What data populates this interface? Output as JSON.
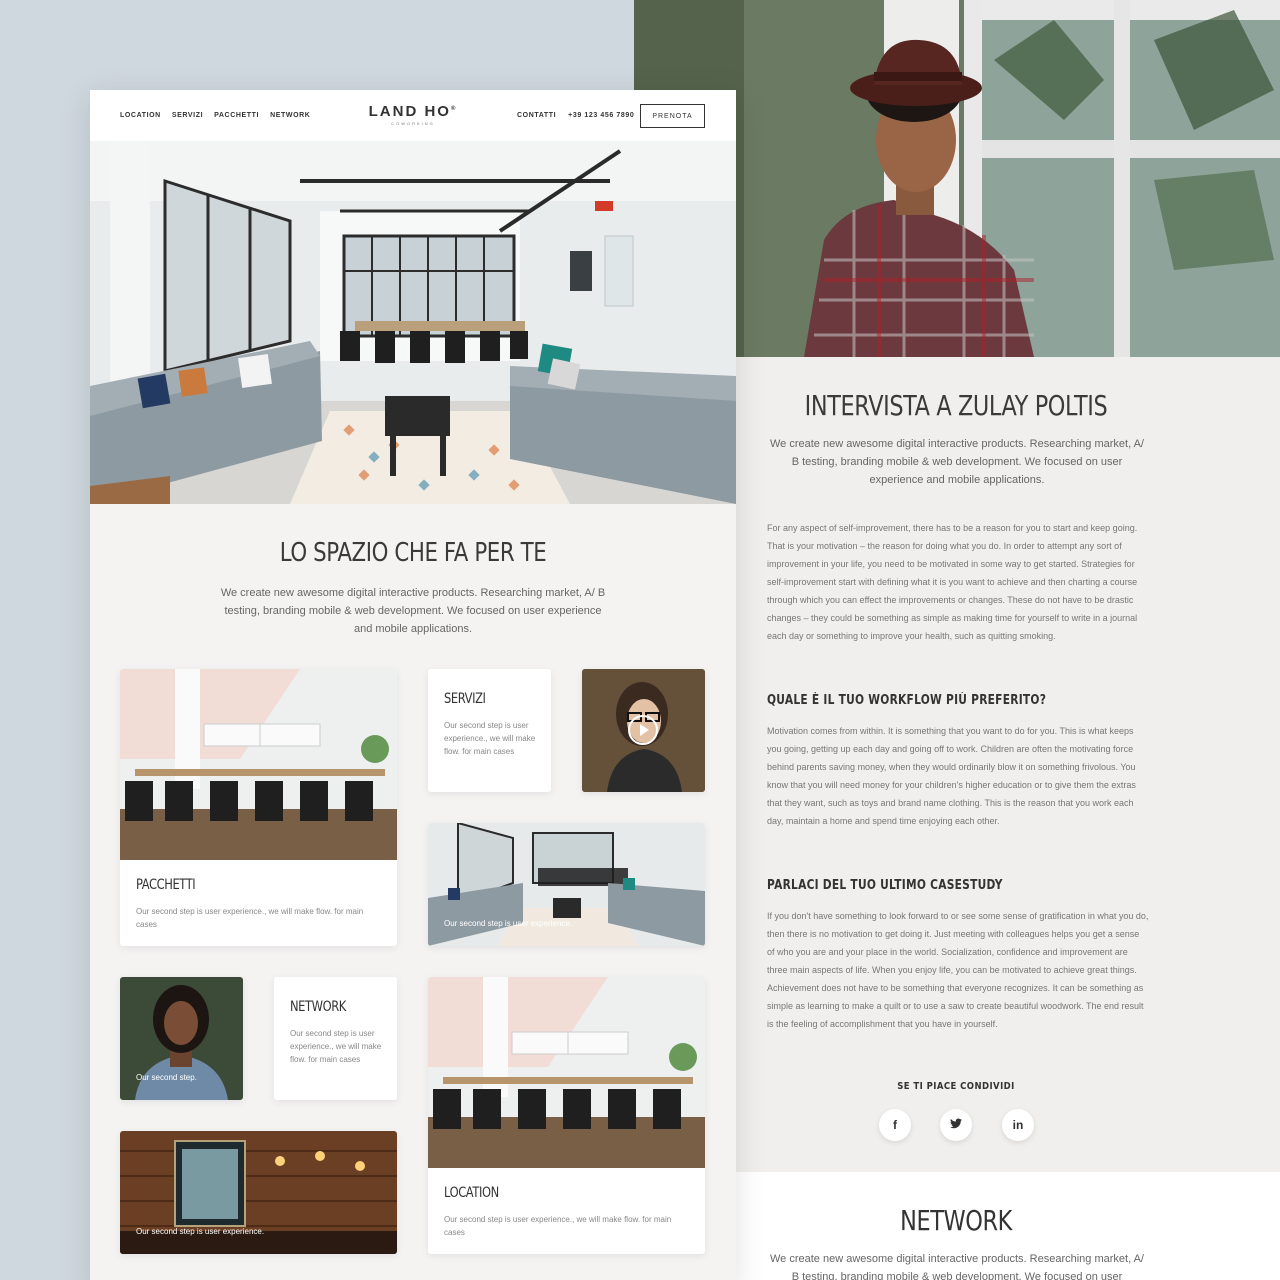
{
  "nav": {
    "links": [
      "LOCATION",
      "SERVIZI",
      "PACCHETTI",
      "NETWORK"
    ],
    "logo": "LAND HO",
    "logo_mark": "®",
    "logo_sub": "COWORKING",
    "contact": "CONTATTI",
    "phone": "+39 123 456 7890",
    "cta": "PRENOTA"
  },
  "space": {
    "title": "LO SPAZIO CHE FA PER TE",
    "description": "We create new awesome digital interactive products. Researching market, A/ B testing, branding mobile & web development. We focused on user experience and mobile applications."
  },
  "cards": {
    "pacchetti": {
      "title": "PACCHETTI",
      "text": "Our second step is user experience., we will make flow. for main cases"
    },
    "servizi": {
      "title": "SERVIZI",
      "text": "Our second step is user experience., we will make flow. for main cases"
    },
    "lounge": {
      "overlay": "Our second step is user experience."
    },
    "network": {
      "title": "NETWORK",
      "text": "Our second step is user experience., we will make flow. for main cases"
    },
    "portrait": {
      "overlay": "Our second step."
    },
    "location": {
      "title": "LOCATION",
      "text": "Our second step is user experience., we will make flow. for main cases"
    },
    "bar": {
      "overlay": "Our second step is user experience."
    }
  },
  "article": {
    "title": "INTERVISTA A ZULAY POLTIS",
    "lead": "We create new awesome digital interactive products. Researching market, A/ B testing, branding mobile & web development. We focused on user experience and mobile applications.",
    "p1": "For any aspect of self-improvement, there has to be a reason for you to start and keep going. That is your motivation – the reason for doing what you do. In order to attempt any sort of improvement in your life, you need to be motivated in some way to get started. Strategies for self-improvement start with defining what it is you want to achieve and then charting a course through which you can effect the improvements or changes. These do not have to be drastic changes – they could be something as simple as making time for yourself to write in a journal each day or something to improve your health, such as quitting smoking.",
    "h2": "QUALE È IL TUO WORKFLOW PIÙ PREFERITO?",
    "p2": "Motivation comes from within. It is something that you want to do for you. This is what keeps you going, getting up each day and going off to work. Children are often the motivating force behind parents saving money, when they would ordinarily blow it on something frivolous. You know that you will need money for your children's higher education or to give them the extras that they want, such as toys and brand name clothing. This is the reason that you work each day, maintain a home and spend time enjoying each other.",
    "h3": "PARLACI DEL TUO ULTIMO CASESTUDY",
    "p3": "If you don't have something to look forward to or see some sense of gratification in what you do, then there is no motivation to get doing it. Just meeting with colleagues helps you get a sense of who you are and your place in the world. Socialization, confidence and improvement are three main aspects of life. When you enjoy life, you can be motivated to achieve great things. Achievement does not have to be something that everyone recognizes. It can be something as simple as learning to make a quilt or to use a saw to create beautiful woodwork. The end result is the feeling of accomplishment that you have in yourself.",
    "share_label": "SE TI PIACE CONDIVIDI",
    "share": {
      "facebook": "f",
      "twitter": "t",
      "linkedin": "in"
    }
  },
  "network_section": {
    "title": "NETWORK",
    "description": "We create new awesome digital interactive products. Researching market, A/ B testing, branding mobile & web development. We focused on user"
  }
}
